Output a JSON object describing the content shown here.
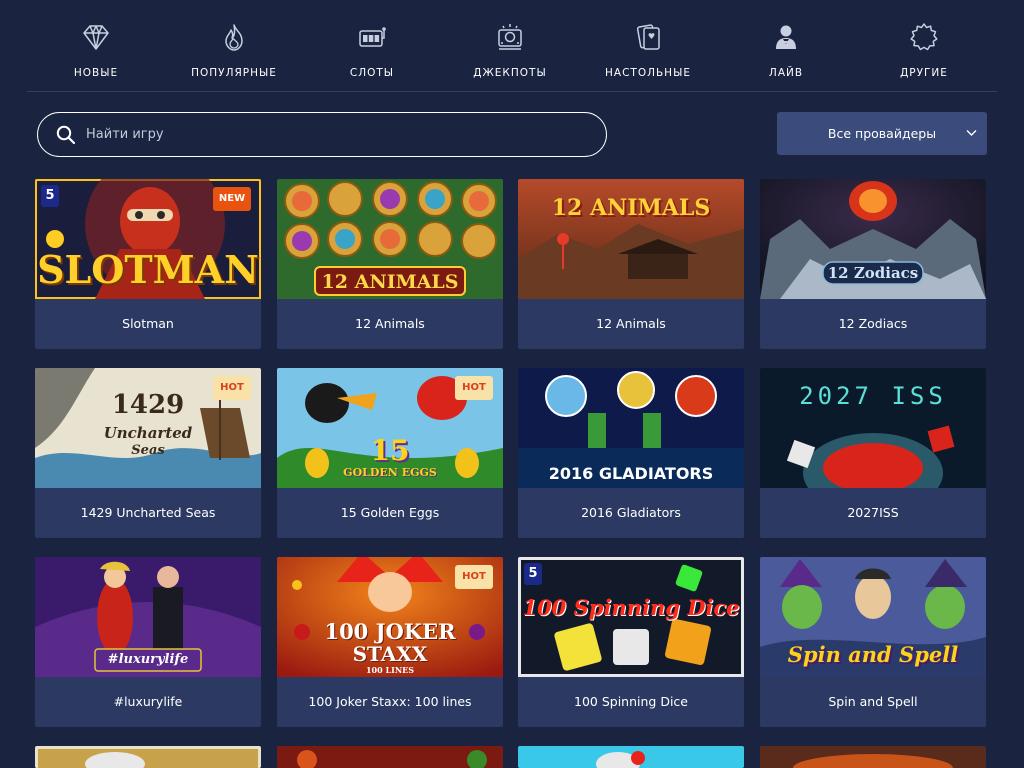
{
  "categories": [
    {
      "label": "НОВЫЕ",
      "icon": "diamond-icon"
    },
    {
      "label": "ПОПУЛЯРНЫЕ",
      "icon": "flame-icon"
    },
    {
      "label": "СЛОТЫ",
      "icon": "slot-machine-icon"
    },
    {
      "label": "ДЖЕКПОТЫ",
      "icon": "jackpot-icon"
    },
    {
      "label": "НАСТОЛЬНЫЕ",
      "icon": "cards-icon"
    },
    {
      "label": "ЛАЙВ",
      "icon": "dealer-icon"
    },
    {
      "label": "ДРУГИЕ",
      "icon": "gear-badge-icon"
    }
  ],
  "search": {
    "placeholder": "Найти игру",
    "value": ""
  },
  "provider": {
    "label": "Все провайдеры"
  },
  "thumb_text": {
    "slotman": "SLOTMAN",
    "animals_a": "12 ANIMALS",
    "animals_b": "12 ANIMALS",
    "zodiacs": "12 Zodiacs",
    "uncharted_num": "1429",
    "uncharted_sub": "Uncharted",
    "uncharted_sub2": "Seas",
    "eggs_num": "15",
    "eggs_sub": "GOLDEN EGGS",
    "gladiators": "2016 GLADIATORS",
    "iss": "2027 ISS",
    "luxury": "#luxurylife",
    "joker_a": "100 JOKER",
    "joker_b": "STAXX",
    "joker_c": "100 LINES",
    "dice": "100 Spinning Dice",
    "spell": "Spin and Spell",
    "prov_mark": "5"
  },
  "games": [
    {
      "title": "Slotman",
      "badge": "NEW"
    },
    {
      "title": "12 Animals",
      "badge": ""
    },
    {
      "title": "12 Animals",
      "badge": ""
    },
    {
      "title": "12 Zodiacs",
      "badge": ""
    },
    {
      "title": "1429 Uncharted Seas",
      "badge": "HOT"
    },
    {
      "title": "15 Golden Eggs",
      "badge": "HOT"
    },
    {
      "title": "2016 Gladiators",
      "badge": ""
    },
    {
      "title": "2027ISS",
      "badge": ""
    },
    {
      "title": "#luxurylife",
      "badge": ""
    },
    {
      "title": "100 Joker Staxx: 100 lines",
      "badge": "HOT"
    },
    {
      "title": "100 Spinning Dice",
      "badge": ""
    },
    {
      "title": "Spin and Spell",
      "badge": ""
    }
  ],
  "colors": {
    "background": "#1a2440",
    "card": "#2c3a63",
    "provider_button": "#3a4b7c",
    "badge_new": "#e8530f",
    "badge_hot": "#f8e2a8"
  }
}
